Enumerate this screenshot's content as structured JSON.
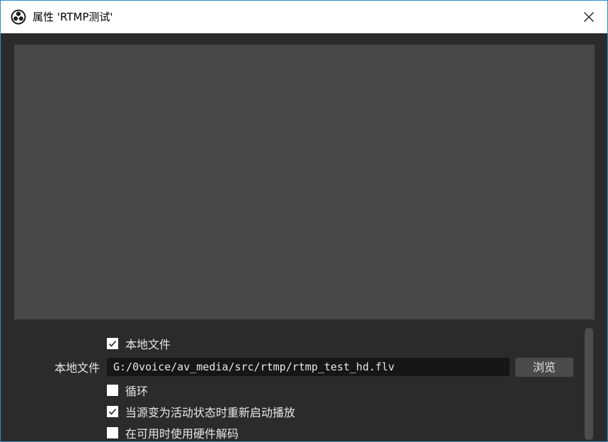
{
  "window": {
    "title": "属性 'RTMP测试'"
  },
  "colors": {
    "background": "#2b2b2b",
    "preview": "#474747",
    "input_background": "#161616",
    "button_background": "#4a4a4a",
    "text": "#e6e6e6",
    "window_border": "#2b8ec9"
  },
  "icons": {
    "app": "obs-logo-icon",
    "close": "close-icon",
    "check": "checkmark-icon"
  },
  "properties": {
    "local_file_toggle": {
      "label": "本地文件",
      "checked": true
    },
    "local_file_path": {
      "label": "本地文件",
      "value": "G:/0voice/av_media/src/rtmp/rtmp_test_hd.flv",
      "browse_label": "浏览"
    },
    "loop": {
      "label": "循环",
      "checked": false
    },
    "restart_on_activate": {
      "label": "当源变为活动状态时重新启动播放",
      "checked": true
    },
    "hw_decode": {
      "label": "在可用时使用硬件解码",
      "checked": false
    }
  }
}
